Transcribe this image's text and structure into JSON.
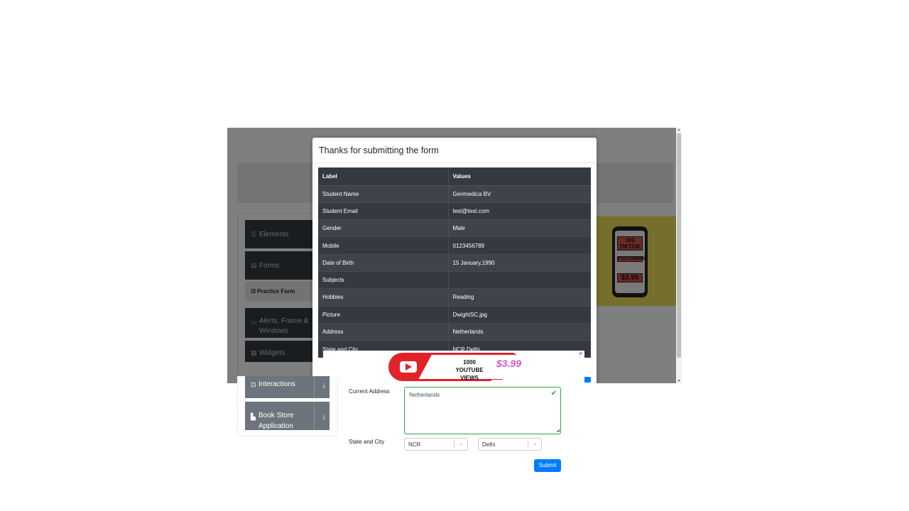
{
  "sidebar": {
    "groups_upper": [
      {
        "label": "Elements",
        "icon": "list-icon"
      },
      {
        "label": "Forms",
        "icon": "form-icon"
      },
      {
        "label": "Alerts, Frame & Windows",
        "icon": "window-icon"
      },
      {
        "label": "Widgets",
        "icon": "widgets-icon"
      }
    ],
    "active_item": "Practice Form",
    "groups_lower": [
      {
        "label": "Interactions",
        "icon": "interactions-icon"
      },
      {
        "label": "Book Store Application",
        "icon": "book-icon"
      }
    ]
  },
  "modal": {
    "title": "Thanks for submitting the form",
    "table": {
      "headers": [
        "Label",
        "Values"
      ],
      "rows": [
        [
          "Student Name",
          "Gerimedica BV"
        ],
        [
          "Student Email",
          "test@test.com"
        ],
        [
          "Gender",
          "Male"
        ],
        [
          "Mobile",
          "0123456789"
        ],
        [
          "Date of Birth",
          "15 January,1990"
        ],
        [
          "Subjects",
          ""
        ],
        [
          "Hobbies",
          "Reading"
        ],
        [
          "Picture",
          "DwightSC.jpg"
        ],
        [
          "Address",
          "Netherlands"
        ],
        [
          "State and City",
          "NCR Delhi"
        ]
      ]
    }
  },
  "ads": {
    "bottom": {
      "line1": "1000",
      "line2": "YOUTUBE VIEWS",
      "price": "$3.99",
      "close": "✕"
    },
    "right": {
      "tag1": "100 TIKTOK",
      "tag2": "FOLLOWERS",
      "price": "$3.99"
    }
  },
  "form": {
    "current_address_label": "Current Address",
    "current_address_value": "Netherlands",
    "state_city_label": "State and City",
    "state_value": "NCR",
    "city_value": "Delhi",
    "submit_label": "Submit"
  },
  "colors": {
    "primary": "#007bff",
    "success": "#28a745",
    "dark": "#343a40",
    "menu": "#6c757d"
  }
}
